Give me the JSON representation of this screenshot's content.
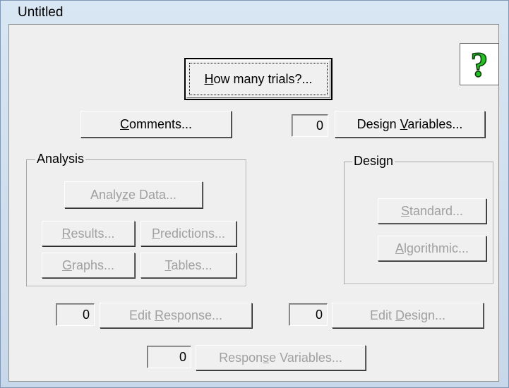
{
  "window": {
    "title": "Untitled"
  },
  "buttons": {
    "how_many_trials": {
      "pre": "",
      "key": "H",
      "post": "ow many trials?..."
    },
    "comments": {
      "pre": "",
      "key": "C",
      "post": "omments..."
    },
    "design_variables": {
      "pre": "Design ",
      "key": "V",
      "post": "ariables..."
    },
    "analyze_data": {
      "pre": "Analy",
      "key": "z",
      "post": "e Data..."
    },
    "results": {
      "pre": "",
      "key": "R",
      "post": "esults..."
    },
    "predictions": {
      "pre": "",
      "key": "P",
      "post": "redictions..."
    },
    "graphs": {
      "pre": "",
      "key": "G",
      "post": "raphs..."
    },
    "tables": {
      "pre": "",
      "key": "T",
      "post": "ables..."
    },
    "standard": {
      "pre": "",
      "key": "S",
      "post": "tandard..."
    },
    "algorithmic": {
      "pre": "",
      "key": "A",
      "post": "lgorithmic..."
    },
    "edit_response": {
      "pre": "Edit ",
      "key": "R",
      "post": "esponse..."
    },
    "edit_design": {
      "pre": "Edit ",
      "key": "D",
      "post": "esign..."
    },
    "response_variables": {
      "pre": "Respon",
      "key": "s",
      "post": "e Variables..."
    }
  },
  "counts": {
    "design_variables": "0",
    "edit_response": "0",
    "edit_design": "0",
    "response_variables": "0"
  },
  "groups": {
    "analysis": "Analysis",
    "design": "Design"
  },
  "help": {
    "icon": "question-mark-icon",
    "glyph": "?",
    "color": "#18a018"
  }
}
